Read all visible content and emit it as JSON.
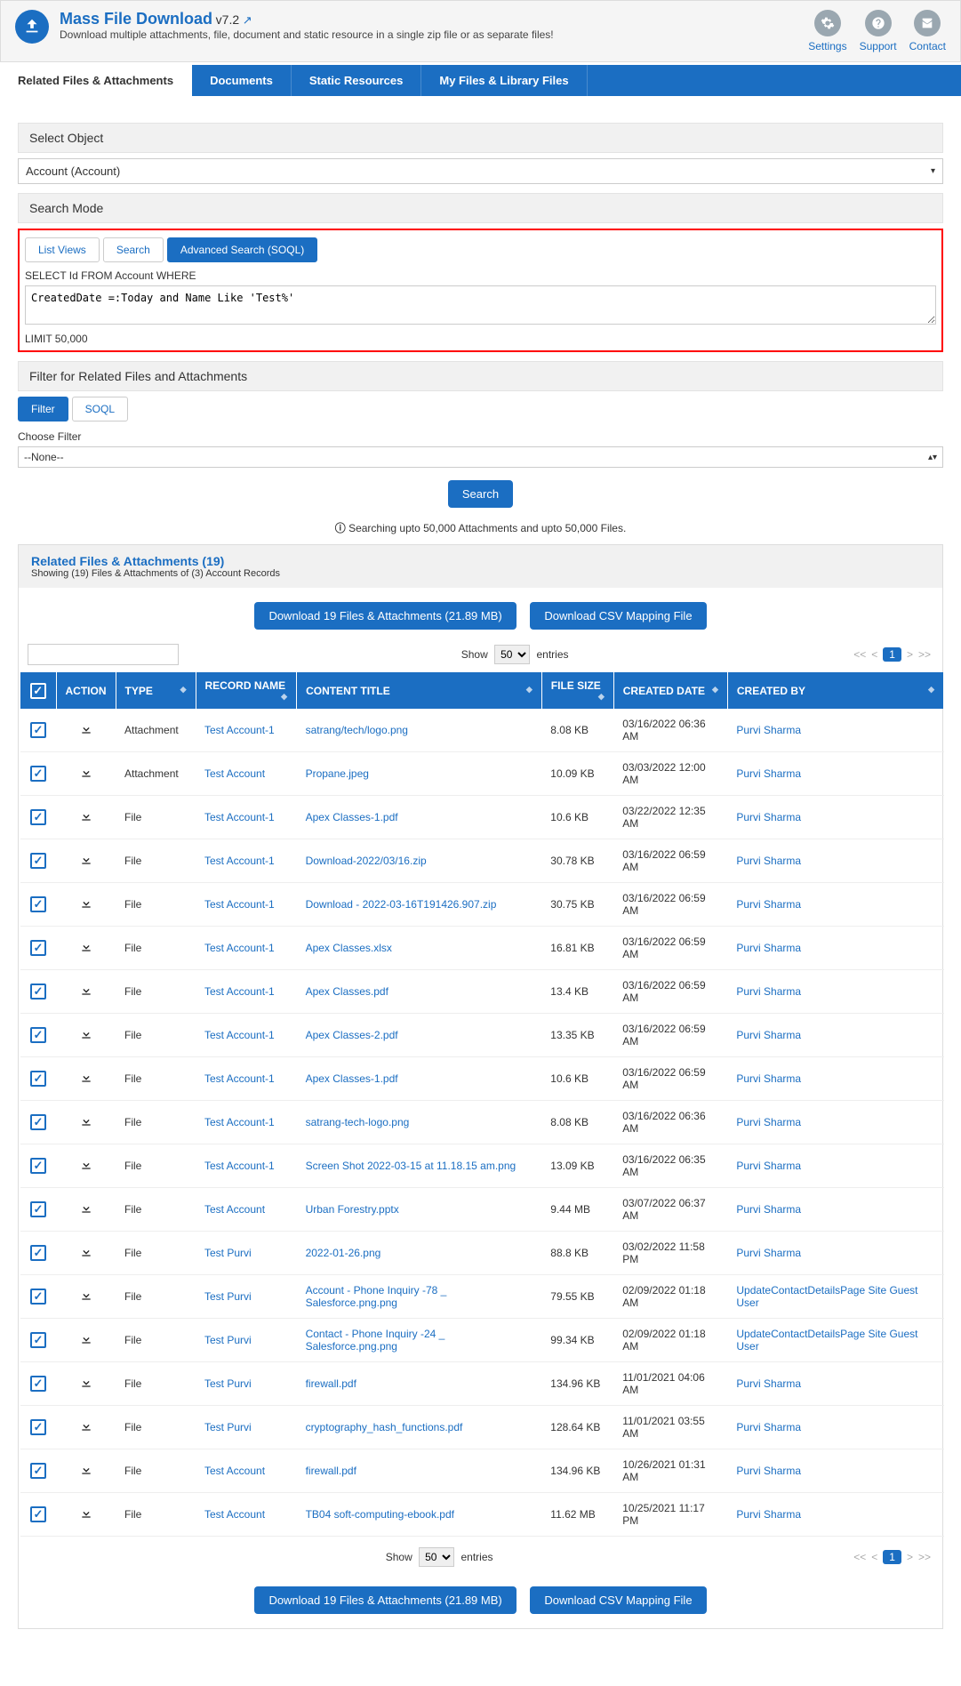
{
  "header": {
    "title": "Mass File Download",
    "version": "v7.2",
    "subtitle": "Download multiple attachments, file, document and static resource in a single zip file or as separate files!",
    "actions": [
      {
        "label": "Settings"
      },
      {
        "label": "Support"
      },
      {
        "label": "Contact"
      }
    ]
  },
  "main_tabs": [
    {
      "label": "Related Files & Attachments",
      "active": true
    },
    {
      "label": "Documents",
      "active": false
    },
    {
      "label": "Static Resources",
      "active": false
    },
    {
      "label": "My Files & Library Files",
      "active": false
    }
  ],
  "select_object": {
    "label": "Select Object",
    "value": "Account (Account)"
  },
  "search_mode": {
    "label": "Search Mode",
    "tabs": [
      {
        "label": "List Views",
        "active": false
      },
      {
        "label": "Search",
        "active": false
      },
      {
        "label": "Advanced Search (SOQL)",
        "active": true
      }
    ],
    "soql_prefix": "SELECT Id FROM Account WHERE",
    "soql_body": "CreatedDate =:Today and Name Like 'Test%'",
    "limit_text": "LIMIT 50,000"
  },
  "filter_section": {
    "label": "Filter for Related Files and Attachments",
    "tabs": [
      {
        "label": "Filter",
        "active": true
      },
      {
        "label": "SOQL",
        "active": false
      }
    ],
    "choose_filter_label": "Choose Filter",
    "filter_value": "--None--"
  },
  "search_button": "Search",
  "info_text": "Searching upto 50,000 Attachments and upto 50,000 Files.",
  "results": {
    "title": "Related Files & Attachments (19)",
    "subtitle": "Showing (19) Files & Attachments of (3) Account Records",
    "download_btn": "Download 19 Files & Attachments (21.89 MB)",
    "csv_btn": "Download CSV Mapping File",
    "show_label_pre": "Show",
    "show_value": "50",
    "show_label_post": "entries",
    "columns": [
      "",
      "ACTION",
      "TYPE",
      "RECORD NAME",
      "CONTENT TITLE",
      "FILE SIZE",
      "CREATED DATE",
      "CREATED BY"
    ],
    "rows": [
      {
        "type": "Attachment",
        "record": "Test Account-1",
        "title": "satrang/tech/logo.png",
        "size": "8.08 KB",
        "date": "03/16/2022 06:36 AM",
        "by": "Purvi Sharma"
      },
      {
        "type": "Attachment",
        "record": "Test Account",
        "title": "Propane.jpeg",
        "size": "10.09 KB",
        "date": "03/03/2022 12:00 AM",
        "by": "Purvi Sharma"
      },
      {
        "type": "File",
        "record": "Test Account-1",
        "title": "Apex Classes-1.pdf",
        "size": "10.6 KB",
        "date": "03/22/2022 12:35 AM",
        "by": "Purvi Sharma"
      },
      {
        "type": "File",
        "record": "Test Account-1",
        "title": "Download-2022/03/16.zip",
        "size": "30.78 KB",
        "date": "03/16/2022 06:59 AM",
        "by": "Purvi Sharma"
      },
      {
        "type": "File",
        "record": "Test Account-1",
        "title": "Download - 2022-03-16T191426.907.zip",
        "size": "30.75 KB",
        "date": "03/16/2022 06:59 AM",
        "by": "Purvi Sharma"
      },
      {
        "type": "File",
        "record": "Test Account-1",
        "title": "Apex Classes.xlsx",
        "size": "16.81 KB",
        "date": "03/16/2022 06:59 AM",
        "by": "Purvi Sharma"
      },
      {
        "type": "File",
        "record": "Test Account-1",
        "title": "Apex Classes.pdf",
        "size": "13.4 KB",
        "date": "03/16/2022 06:59 AM",
        "by": "Purvi Sharma"
      },
      {
        "type": "File",
        "record": "Test Account-1",
        "title": "Apex Classes-2.pdf",
        "size": "13.35 KB",
        "date": "03/16/2022 06:59 AM",
        "by": "Purvi Sharma"
      },
      {
        "type": "File",
        "record": "Test Account-1",
        "title": "Apex Classes-1.pdf",
        "size": "10.6 KB",
        "date": "03/16/2022 06:59 AM",
        "by": "Purvi Sharma"
      },
      {
        "type": "File",
        "record": "Test Account-1",
        "title": "satrang-tech-logo.png",
        "size": "8.08 KB",
        "date": "03/16/2022 06:36 AM",
        "by": "Purvi Sharma"
      },
      {
        "type": "File",
        "record": "Test Account-1",
        "title": "Screen Shot 2022-03-15 at 11.18.15 am.png",
        "size": "13.09 KB",
        "date": "03/16/2022 06:35 AM",
        "by": "Purvi Sharma"
      },
      {
        "type": "File",
        "record": "Test Account",
        "title": "Urban Forestry.pptx",
        "size": "9.44 MB",
        "date": "03/07/2022 06:37 AM",
        "by": "Purvi Sharma"
      },
      {
        "type": "File",
        "record": "Test Purvi",
        "title": "2022-01-26.png",
        "size": "88.8 KB",
        "date": "03/02/2022 11:58 PM",
        "by": "Purvi Sharma"
      },
      {
        "type": "File",
        "record": "Test Purvi",
        "title": "Account - Phone Inquiry -78 _ Salesforce.png.png",
        "size": "79.55 KB",
        "date": "02/09/2022 01:18 AM",
        "by": "UpdateContactDetailsPage Site Guest User"
      },
      {
        "type": "File",
        "record": "Test Purvi",
        "title": "Contact - Phone Inquiry -24 _ Salesforce.png.png",
        "size": "99.34 KB",
        "date": "02/09/2022 01:18 AM",
        "by": "UpdateContactDetailsPage Site Guest User"
      },
      {
        "type": "File",
        "record": "Test Purvi",
        "title": "firewall.pdf",
        "size": "134.96 KB",
        "date": "11/01/2021 04:06 AM",
        "by": "Purvi Sharma"
      },
      {
        "type": "File",
        "record": "Test Purvi",
        "title": "cryptography_hash_functions.pdf",
        "size": "128.64 KB",
        "date": "11/01/2021 03:55 AM",
        "by": "Purvi Sharma"
      },
      {
        "type": "File",
        "record": "Test Account",
        "title": "firewall.pdf",
        "size": "134.96 KB",
        "date": "10/26/2021 01:31 AM",
        "by": "Purvi Sharma"
      },
      {
        "type": "File",
        "record": "Test Account",
        "title": "TB04  soft-computing-ebook.pdf",
        "size": "11.62 MB",
        "date": "10/25/2021 11:17 PM",
        "by": "Purvi Sharma"
      }
    ]
  }
}
